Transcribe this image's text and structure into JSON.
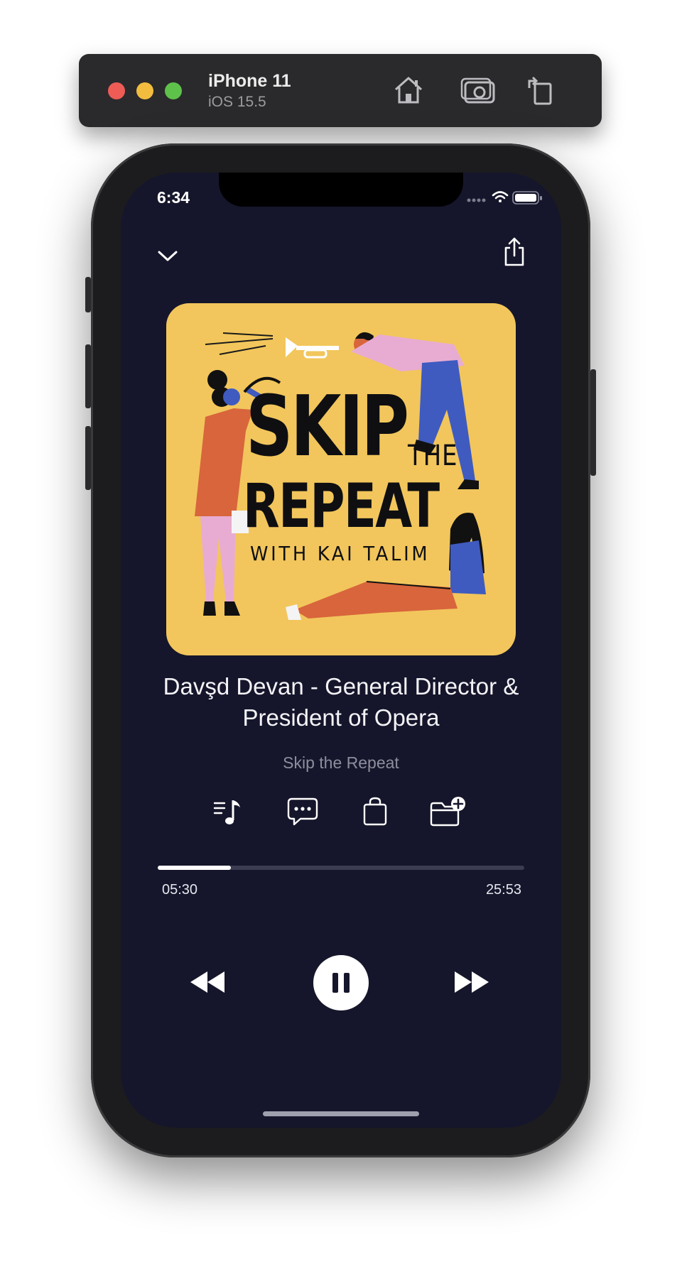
{
  "simulator": {
    "device_name": "iPhone 11",
    "os_version": "iOS 15.5",
    "toolbar_icons": [
      "home-icon",
      "screenshot-icon",
      "rotate-icon"
    ]
  },
  "status_bar": {
    "time": "6:34",
    "icons": [
      "cellular-icon",
      "wifi-icon",
      "battery-icon"
    ]
  },
  "player": {
    "artwork": {
      "line1": "SKIP",
      "line1b": "THE",
      "line2": "REPEAT",
      "line3": "WITH KAI TALIM"
    },
    "episode_title": "Davşd Devan - General Director & President of Opera",
    "podcast_name": "Skip the Repeat",
    "actions": [
      "playlist-icon",
      "transcript-icon",
      "shop-icon",
      "add-to-folder-icon"
    ],
    "progress_fraction": 0.2,
    "elapsed": "05:30",
    "duration": "25:53",
    "controls": [
      "rewind-icon",
      "pause-icon",
      "fast-forward-icon"
    ]
  },
  "colors": {
    "screen_bg": "#15162b",
    "artwork_bg": "#f2c65c",
    "text_primary": "#f3f3f7",
    "text_secondary": "#8d8e9c",
    "progress_fill": "#ffffff",
    "progress_track": "#3b3c52"
  }
}
